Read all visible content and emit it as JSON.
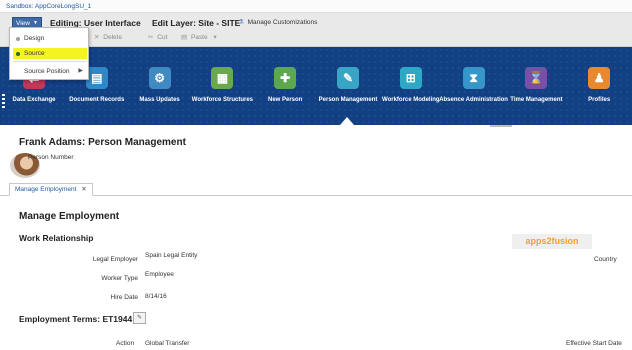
{
  "sandbox": {
    "text": "Sandbox: AppCoreLongSU_1"
  },
  "toolbar": {
    "view_label": "View",
    "editing": "Editing: User Interface",
    "edit_layer": "Edit Layer: Site - SITE",
    "manage_customizations": "Manage Customizations",
    "delete_label": "Delete",
    "cut_label": "Cut",
    "paste_label": "Paste"
  },
  "view_menu": {
    "items": [
      {
        "label": "Design",
        "selected": false
      },
      {
        "label": "Source",
        "selected": true
      },
      {
        "label": "Source Position",
        "has_submenu": true
      }
    ],
    "highlight_color": "#f4f423"
  },
  "nav": {
    "background": "#134082",
    "items": [
      {
        "label": "Data Exchange",
        "color": "#c0395a",
        "glyph": "⇄"
      },
      {
        "label": "Document Records",
        "color": "#2f88c6",
        "glyph": "▤"
      },
      {
        "label": "Mass Updates",
        "color": "#3f8ac0",
        "glyph": "⚙"
      },
      {
        "label": "Workforce Structures",
        "color": "#6aa84f",
        "glyph": "▦"
      },
      {
        "label": "New Person",
        "color": "#5ba84f",
        "glyph": "✚"
      },
      {
        "label": "Person Management",
        "color": "#3aa4c4",
        "glyph": "✎",
        "active": true
      },
      {
        "label": "Workforce Modeling",
        "color": "#2fa8c6",
        "glyph": "⊞"
      },
      {
        "label": "Absence Administration",
        "color": "#3796c9",
        "glyph": "⧗"
      },
      {
        "label": "Time Management",
        "color": "#7a4fa8",
        "glyph": "⌛"
      },
      {
        "label": "Profiles",
        "color": "#e8892f",
        "glyph": "♟"
      }
    ]
  },
  "page": {
    "person_title": "Frank Adams: Person Management",
    "person_number_label": "Person Number",
    "tab_label": "Manage Employment",
    "section_title": "Manage Employment",
    "work_relationship": "Work Relationship",
    "watermark": "apps2fusion",
    "fields": [
      {
        "label": "Legal Employer",
        "value": "Spain Legal Entity"
      },
      {
        "label": "Worker Type",
        "value": "Employee"
      },
      {
        "label": "Hire Date",
        "value": "8/14/16"
      }
    ],
    "country_label": "Country",
    "employment_terms": "Employment Terms: ET1944",
    "action_label": "Action",
    "action_value": "Global Transfer",
    "effective_start_label": "Effective Start Date"
  }
}
